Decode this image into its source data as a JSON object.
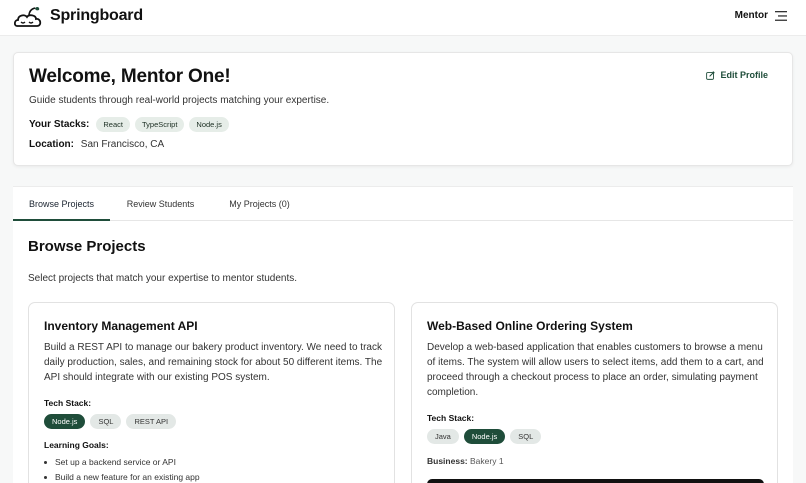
{
  "header": {
    "brand": "Springboard",
    "role": "Mentor",
    "logo_icon": "sprout-cloud-icon",
    "menu_icon": "hamburger-icon"
  },
  "profile": {
    "title": "Welcome, Mentor One!",
    "subtitle": "Guide students through real-world projects matching your expertise.",
    "stacks_label": "Your Stacks:",
    "stacks": [
      "React",
      "TypeScript",
      "Node.js"
    ],
    "location_label": "Location:",
    "location": "San Francisco, CA",
    "edit_label": "Edit Profile",
    "edit_icon": "edit-icon"
  },
  "tabs": [
    {
      "label": "Browse Projects",
      "active": true
    },
    {
      "label": "Review Students",
      "active": false
    },
    {
      "label": "My Projects (0)",
      "active": false
    }
  ],
  "browse": {
    "title": "Browse Projects",
    "subtitle": "Select projects that match your expertise to mentor students."
  },
  "projects": [
    {
      "title": "Inventory Management API",
      "description": "Build a REST API to manage our bakery product inventory. We need to track daily production, sales, and remaining stock for about 50 different items. The API should integrate with our existing POS system.",
      "tech_label": "Tech Stack:",
      "tech": [
        "Node.js",
        "SQL",
        "REST API"
      ],
      "goals_label": "Learning Goals:",
      "goals": [
        "Set up a backend service or API",
        "Build a new feature for an existing app"
      ]
    },
    {
      "title": "Web-Based Online Ordering System",
      "description": "Develop a web-based application that enables customers to browse a menu of items. The system will allow users to select items, add them to a cart, and proceed through a checkout process to place an order, simulating payment completion.",
      "tech_label": "Tech Stack:",
      "tech": [
        "Java",
        "Node.js",
        "SQL"
      ],
      "business_label": "Business:",
      "business": "Bakery 1"
    }
  ],
  "colors": {
    "accent": "#1f4d3a",
    "tag_bg": "#e6ede8",
    "page_bg": "#f7f8f8"
  }
}
